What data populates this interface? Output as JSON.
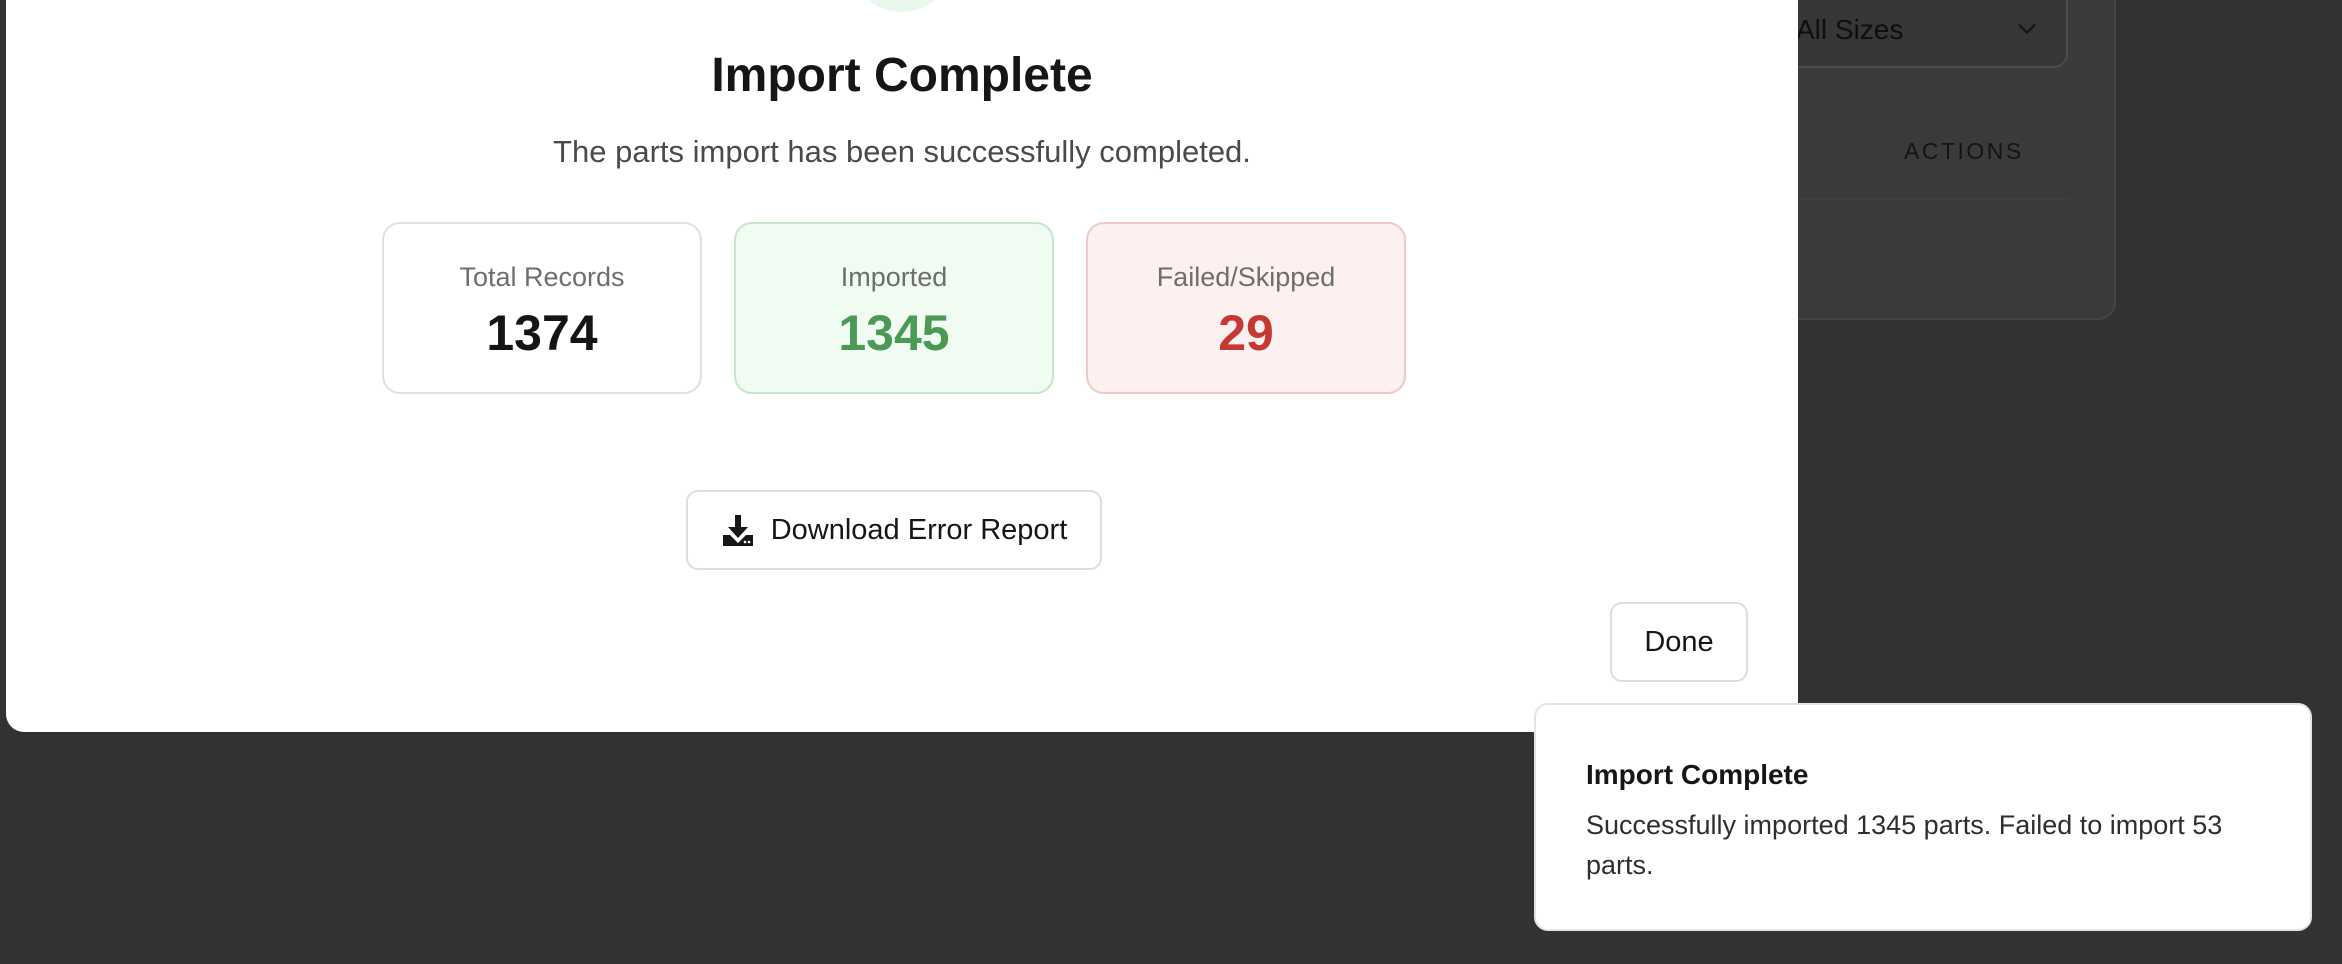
{
  "background": {
    "size_filter": {
      "value": "All Sizes",
      "icon": "chevron-down-icon"
    },
    "table": {
      "actions_header": "ACTIONS"
    }
  },
  "modal": {
    "status_icon": "success-check-icon",
    "title": "Import Complete",
    "subtitle": "The parts import has been successfully completed.",
    "stats": {
      "total": {
        "label": "Total Records",
        "value": "1374"
      },
      "imported": {
        "label": "Imported",
        "value": "1345",
        "color": "#4a9a55"
      },
      "failed": {
        "label": "Failed/Skipped",
        "value": "29",
        "color": "#c43a33"
      }
    },
    "download_button": {
      "label": "Download Error Report",
      "icon": "download-icon"
    },
    "done_button": {
      "label": "Done"
    }
  },
  "toast": {
    "title": "Import Complete",
    "message": "Successfully imported 1345 parts. Failed to import 53 parts."
  }
}
